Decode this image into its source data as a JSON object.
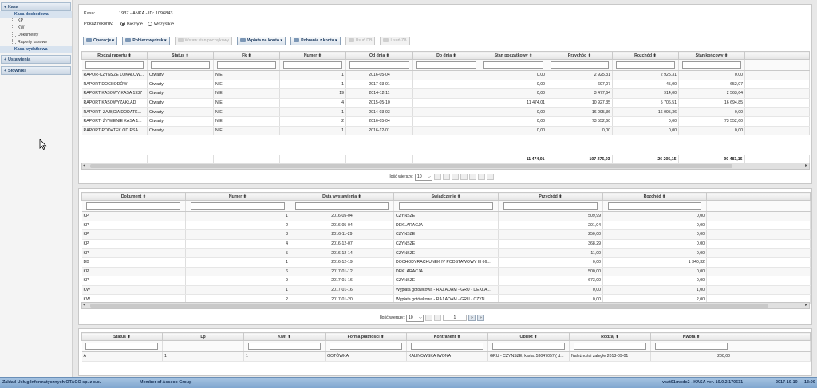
{
  "sidebar": {
    "kasa": "Kasa",
    "kasa_dochodowa": "Kasa dochodowa",
    "items": [
      "KP",
      "KW",
      "Dokumenty",
      "Raporty kasowe"
    ],
    "kasa_wydatkowa": "Kasa wydatkowa",
    "ustawienia": "Ustawienia",
    "slowniki": "Słowniki"
  },
  "info": {
    "kasa_label": "Kasa:",
    "kasa_value": "1937 - ANKA - ID: 1096843.",
    "pokaz_label": "Pokaż rekordy:",
    "opt_biezace": "Bieżące",
    "opt_wszystkie": "Wszystkie"
  },
  "toolbar": {
    "operacje": "Operacje ▾",
    "pobierz": "Pobierz wydruk ▾",
    "wstaw": "Wstaw stan początkowy",
    "wplata": "Wpłata na konto ▾",
    "pobranie": "Pobranie z konta ▾",
    "usun_db": "Usuń DB",
    "usun_zb": "Usuń ZB"
  },
  "raporty": {
    "headers": [
      "Rodzaj raportu ⬍",
      "Status ⬍",
      "Fk ⬍",
      "Numer ⬍",
      "Od dnia ⬍",
      "Do dnia ⬍",
      "Stan początkowy ⬍",
      "Przychód ⬍",
      "Rozchód ⬍",
      "Stan końcowy ⬍"
    ],
    "rows": [
      [
        "RAPOR-CZYNSZE LOKALOW...",
        "Otwarty",
        "NIE",
        "1",
        "2016-05-04",
        "",
        "0,00",
        "2 925,31",
        "2 925,31",
        "0,00"
      ],
      [
        "RAPORT DOCHODÓW",
        "Otwarty",
        "NIE",
        "1",
        "2017-03-01",
        "",
        "0,00",
        "697,07",
        "45,00",
        "652,07"
      ],
      [
        "RAPORT KASOWY KASA 1937",
        "Otwarty",
        "NIE",
        "19",
        "2014-12-11",
        "",
        "0,00",
        "3 477,64",
        "914,00",
        "2 563,64"
      ],
      [
        "RAPORT KASOWYZAKŁAD",
        "Otwarty",
        "NIE",
        "4",
        "2015-05-10",
        "",
        "11 474,01",
        "10 927,35",
        "5 706,51",
        "16 694,85"
      ],
      [
        "RAPORT- ZAJĘCIA DODATK...",
        "Otwarty",
        "NIE",
        "1",
        "2014-03-03",
        "",
        "0,00",
        "16 095,36",
        "16 095,36",
        "0,00"
      ],
      [
        "RAPORT- ŻYWIENIE KASA 1...",
        "Otwarty",
        "NIE",
        "2",
        "2016-05-04",
        "",
        "0,00",
        "73 552,60",
        "0,00",
        "73 552,60"
      ],
      [
        "RAPORT-PODATEK OD PSA",
        "Otwarty",
        "NIE",
        "1",
        "2016-12-01",
        "",
        "0,00",
        "0,00",
        "0,00",
        "0,00"
      ]
    ],
    "totals": [
      "11 474,01",
      "107 276,03",
      "26 205,15",
      "90 483,16"
    ],
    "ilosc_label": "Ilość wierszy:",
    "ilosc_value": "10"
  },
  "dokumenty": {
    "headers": [
      "Dokument ⬍",
      "Numer ⬍",
      "Data wystawienia ⬍",
      "Świadczenie ⬍",
      "Przychód ⬍",
      "Rozchód ⬍"
    ],
    "rows": [
      [
        "KP",
        "1",
        "2016-05-04",
        "CZYNSZE",
        "509,99",
        "0,00"
      ],
      [
        "KP",
        "2",
        "2016-05-04",
        "DEKLARACJA",
        "201,04",
        "0,00"
      ],
      [
        "KP",
        "3",
        "2016-11-29",
        "CZYNSZE",
        "250,00",
        "0,00"
      ],
      [
        "KP",
        "4",
        "2016-12-07",
        "CZYNSZE",
        "368,29",
        "0,00"
      ],
      [
        "KP",
        "5",
        "2016-12-14",
        "CZYNSZE",
        "11,00",
        "0,00"
      ],
      [
        "DB",
        "1",
        "2016-12-19",
        "DOCHODYRACHUNEK IV PODSTAWOWY III 66...",
        "0,00",
        "1 340,32"
      ],
      [
        "KP",
        "6",
        "2017-01-12",
        "DEKLARACJA",
        "500,00",
        "0,00"
      ],
      [
        "KP",
        "9",
        "2017-01-16",
        "CZYNSZE",
        "673,00",
        "0,00"
      ],
      [
        "KW",
        "1",
        "2017-01-16",
        "Wypłata gotówkowa - RAJ ADAM - GRU - DEKLA...",
        "0,00",
        "1,00"
      ],
      [
        "KW",
        "2",
        "2017-01-20",
        "Wypłata gotówkowa - RAJ ADAM - GRU - CZYN...",
        "0,00",
        "2,00"
      ]
    ],
    "ilosc_label": "Ilość wierszy:",
    "ilosc_value": "10",
    "page": "1"
  },
  "kwity": {
    "headers": [
      "Status ⬍",
      "Lp",
      "Kwit ⬍",
      "Forma płatności ⬍",
      "Kontrahent ⬍",
      "Obiekt ⬍",
      "Rodzaj ⬍",
      "Kwota ⬍"
    ],
    "rows": [
      [
        "A",
        "1",
        "1",
        "GOTÓWKA",
        "KALINOWSKA IWONA",
        "GRU - CZYNSZE, karta: 53047057 ( d...",
        "Należności zaległe 2013-09-01",
        "200,00"
      ]
    ]
  },
  "status": {
    "left": "Zakład Usług Informatycznych OTAGO sp. z o.o.",
    "member": "Member of Asseco Group",
    "right": "vsat01:node2 - KASA  ver. 10.0.2.170631",
    "date": "2017-10-10",
    "time": "13:00"
  }
}
